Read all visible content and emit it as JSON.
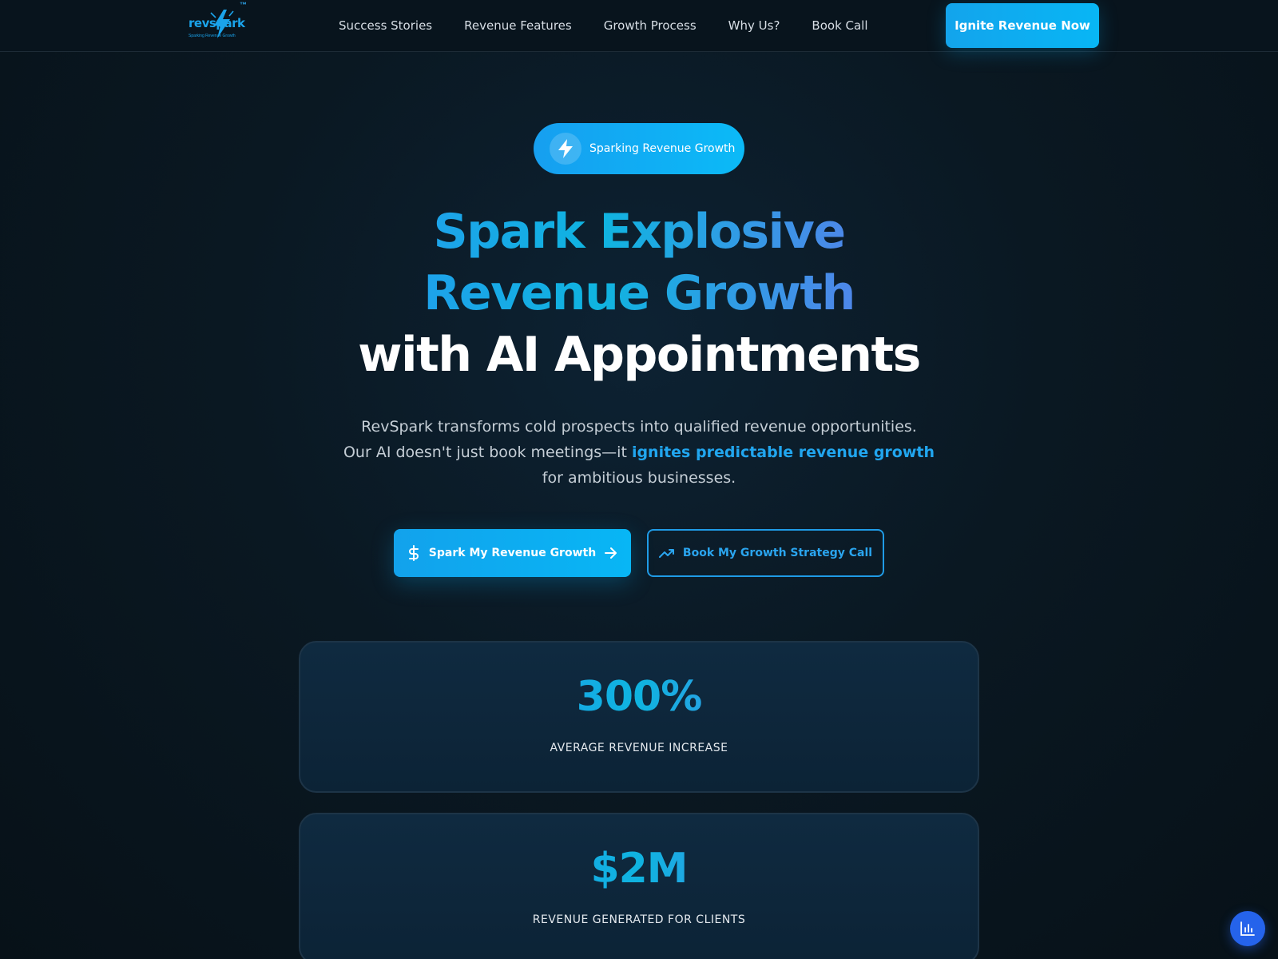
{
  "brand": {
    "logo_text": "revspark",
    "trademark": "™",
    "tagline": "Sparking Revenue Growth"
  },
  "nav": {
    "items": [
      "Success Stories",
      "Revenue Features",
      "Growth Process",
      "Why Us?",
      "Book Call"
    ],
    "cta_label": "Ignite Revenue Now"
  },
  "hero": {
    "badge_icon": "lightning-bolt-icon",
    "badge_label": "Sparking Revenue Growth",
    "headline_line1": "Spark Explosive",
    "headline_line2": "Revenue Growth",
    "headline_line3": "with AI Appointments",
    "subtext_line1": "RevSpark transforms cold prospects into qualified revenue opportunities.",
    "subtext_line2_before": "Our AI doesn't just book meetings—it ",
    "subtext_highlight": "ignites predictable revenue growth",
    "subtext_line3": "for ambitious businesses.",
    "primary_button": {
      "label": "Spark My Revenue Growth",
      "icons": [
        "dollar-icon",
        "arrow-right-icon"
      ]
    },
    "secondary_button": {
      "label": "Book My Growth Strategy Call",
      "icon": "trending-up-icon"
    }
  },
  "stats": [
    {
      "value": "300%",
      "label": "AVERAGE REVENUE INCREASE"
    },
    {
      "value": "$2M",
      "label": "REVENUE GENERATED FOR CLIENTS"
    }
  ],
  "floating_button": {
    "icon": "bar-chart-icon"
  },
  "colors": {
    "accent": "#0ab4f5",
    "accent_blue": "#2d8ff5",
    "accent_purple": "#7b66f0",
    "background": "#0a1822",
    "fab": "#2563eb"
  }
}
